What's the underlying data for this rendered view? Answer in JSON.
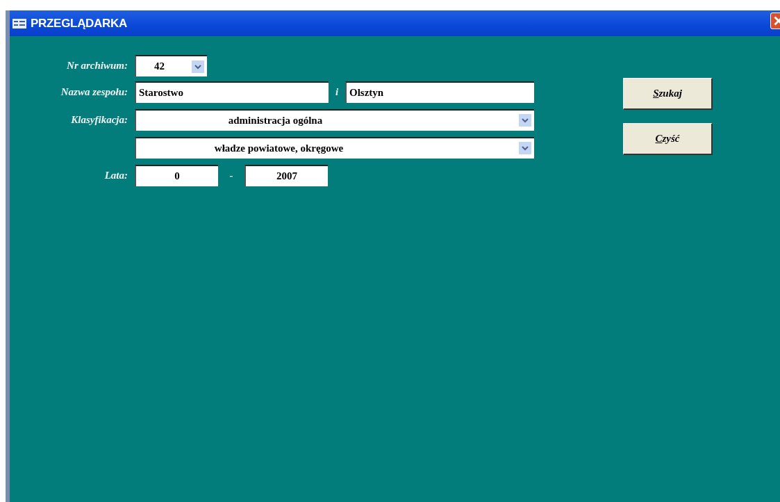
{
  "window": {
    "title": "PRZEGLĄDARKA"
  },
  "fields": {
    "archive_number": {
      "label": "Nr archiwum:",
      "value": "42"
    },
    "fonds_name": {
      "label": "Nazwa zespołu:",
      "value": "Starostwo",
      "joiner": "i",
      "value_2": "Olsztyn"
    },
    "classification": {
      "label": "Klasyfikacja:",
      "value": "administracja ogólna",
      "value_2": "władze powiatowe, okręgowe"
    },
    "years": {
      "label": "Lata:",
      "from": "0",
      "separator": "-",
      "to": "2007"
    }
  },
  "buttons": [
    {
      "label": "Szukaj"
    },
    {
      "label": "Czyść"
    }
  ]
}
